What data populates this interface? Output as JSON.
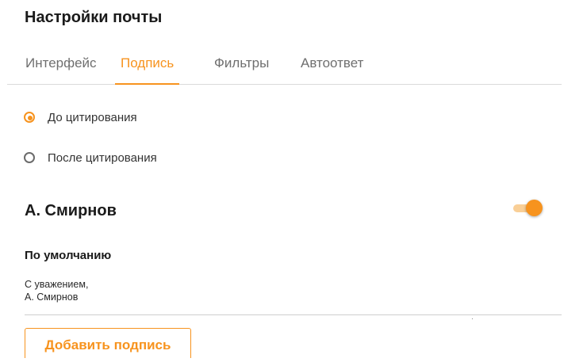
{
  "header": {
    "title": "Настройки почты"
  },
  "tabs": [
    {
      "label": "Интерфейс",
      "active": false
    },
    {
      "label": "Подпись",
      "active": true
    },
    {
      "label": "Фильтры",
      "active": false
    },
    {
      "label": "Автоответ",
      "active": false
    }
  ],
  "placement": {
    "options": [
      {
        "label": "До цитирования",
        "selected": true
      },
      {
        "label": "После цитирования",
        "selected": false
      }
    ]
  },
  "signature": {
    "name": "А. Смирнов",
    "enabled": true,
    "default_label": "По умолчанию",
    "text_lines": [
      "С уважением,",
      "А. Смирнов"
    ]
  },
  "actions": {
    "add_signature_label": "Добавить подпись"
  },
  "colors": {
    "accent": "#f7931e",
    "accent_light": "#f9cf97",
    "text": "#1a1a1a",
    "muted": "#6f6f6f"
  }
}
